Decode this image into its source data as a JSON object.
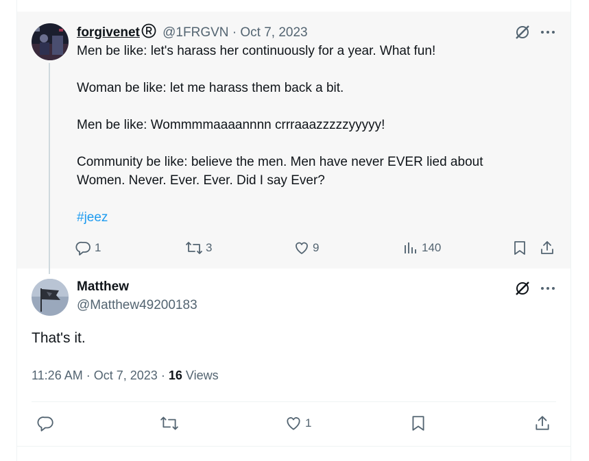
{
  "parent_tweet": {
    "display_name": "forgivenet",
    "handle": "@1FRGVN",
    "separator": "·",
    "date": "Oct 7, 2023",
    "text_lines": [
      "Men be like: let's harass her continuously for a year. What fun!",
      "Woman be like: let me harass them back a bit.",
      "Men be like: Wommmmaaaannnn crrraaazzzzzyyyyy!",
      "Community be like: believe the men. Men have never EVER lied about",
      "Women. Never. Ever. Ever. Did I say Ever?"
    ],
    "hashtag": "#jeez",
    "actions": {
      "replies": "1",
      "reposts": "3",
      "likes": "9",
      "views": "140"
    }
  },
  "main_tweet": {
    "display_name": "Matthew",
    "handle": "@Matthew49200183",
    "text": "That's it.",
    "time": "11:26 AM",
    "separator": "·",
    "date": "Oct 7, 2023",
    "separator2": "·",
    "views_count": "16",
    "views_label": "Views",
    "actions": {
      "likes": "1"
    }
  },
  "icons": {
    "grok": "grok-icon",
    "more": "more-icon",
    "reply": "reply-icon",
    "repost": "repost-icon",
    "like": "heart-icon",
    "views": "analytics-icon",
    "bookmark": "bookmark-icon",
    "share": "share-icon"
  }
}
